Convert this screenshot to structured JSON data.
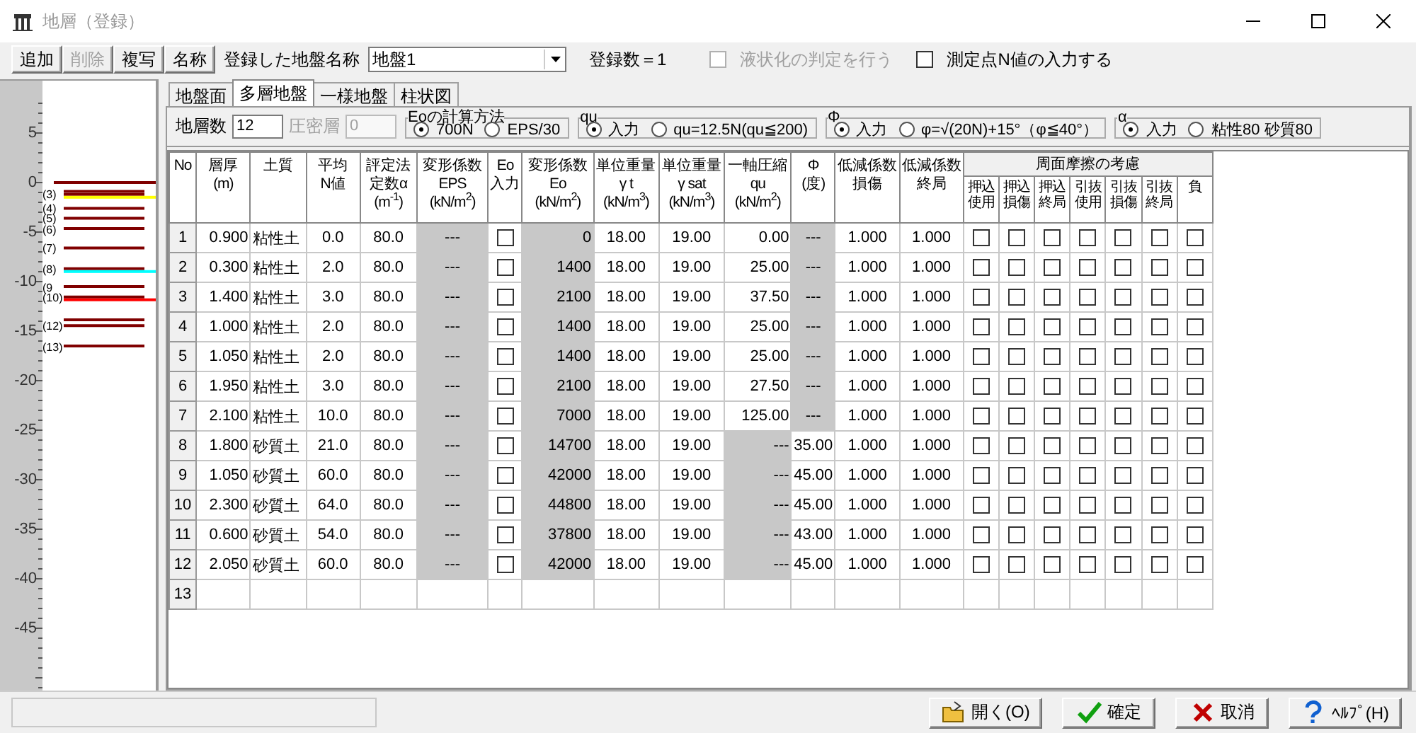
{
  "window": {
    "title": "地層（登録）",
    "active": false
  },
  "toolbar": {
    "buttons": [
      {
        "label": "追加",
        "disabled": false
      },
      {
        "label": "削除",
        "disabled": true
      },
      {
        "label": "複写",
        "disabled": false
      },
      {
        "label": "名称",
        "disabled": false
      }
    ],
    "name_label": "登録した地盤名称",
    "name_value": "地盤1",
    "count": "登録数＝1",
    "checkboxes": [
      {
        "label": "液状化の判定を行う",
        "checked": false,
        "disabled": true
      },
      {
        "label": "測定点N値の入力する",
        "checked": false,
        "disabled": false
      }
    ]
  },
  "strata_view": {
    "ruler": [
      "5",
      "0",
      "-5",
      "-10",
      "-15",
      "-20",
      "-25",
      "-30",
      "-35",
      "-40",
      "-45"
    ]
  },
  "tabs": [
    {
      "label": "地盤面",
      "selected": false
    },
    {
      "label": "多層地盤",
      "selected": true
    },
    {
      "label": "一様地盤",
      "selected": false
    },
    {
      "label": "柱状図",
      "selected": false
    }
  ],
  "settings": {
    "layer_count_label": "地層数",
    "layer_count": "12",
    "consolidation_label": "圧密層",
    "consolidation": "0",
    "consolidation_disabled": true,
    "groups": [
      {
        "title": "Eoの計算方法",
        "options": [
          {
            "label": "700N",
            "selected": true
          },
          {
            "label": "EPS/30",
            "selected": false
          }
        ]
      },
      {
        "title": "qu",
        "options": [
          {
            "label": "入力",
            "selected": true
          },
          {
            "label": "qu=12.5N(qu≦200)",
            "selected": false
          }
        ]
      },
      {
        "title": "Φ",
        "options": [
          {
            "label": "入力",
            "selected": true
          },
          {
            "label": "φ=√(20N)+15°（φ≦40°）",
            "selected": false
          }
        ]
      },
      {
        "title": "α",
        "options": [
          {
            "label": "入力",
            "selected": true
          },
          {
            "label": "粘性80  砂質80",
            "selected": false
          }
        ]
      }
    ]
  },
  "table": {
    "columns": [
      {
        "header": [
          "No"
        ],
        "kind": "no"
      },
      {
        "header": [
          "層厚",
          "(m)"
        ],
        "kind": "value"
      },
      {
        "header": [
          "土質"
        ],
        "kind": "value"
      },
      {
        "header": [
          "平均",
          "N値"
        ],
        "kind": "value"
      },
      {
        "header": [
          "評定法",
          "定数α",
          "(m$^{-1}$)"
        ],
        "kind": "value"
      },
      {
        "header": [
          "変形係数",
          "EPS",
          "(kN/m$^{2}$)"
        ],
        "kind": "value"
      },
      {
        "header": [
          "Eo",
          "入力"
        ],
        "kind": "check"
      },
      {
        "header": [
          "変形係数",
          "Eo",
          "(kN/m$^{2}$)"
        ],
        "kind": "value"
      },
      {
        "header": [
          "単位重量",
          "γ t",
          "(kN/m$^{3}$)"
        ],
        "kind": "value"
      },
      {
        "header": [
          "単位重量",
          "γ sat",
          "(kN/m$^{3}$)"
        ],
        "kind": "value"
      },
      {
        "header": [
          "一軸圧縮",
          "qu",
          "(kN/m$^{2}$)"
        ],
        "kind": "value"
      },
      {
        "header": [
          "Φ",
          "(度)"
        ],
        "kind": "value"
      },
      {
        "header": [
          "低減係数",
          "損傷"
        ],
        "kind": "value"
      },
      {
        "header": [
          "低減係数",
          "終局"
        ],
        "kind": "value"
      }
    ],
    "friction_header": "周面摩擦の考慮",
    "friction_columns": [
      [
        "押込",
        "使用"
      ],
      [
        "押込",
        "損傷"
      ],
      [
        "押込",
        "終局"
      ],
      [
        "引抜",
        "使用"
      ],
      [
        "引抜",
        "損傷"
      ],
      [
        "引抜",
        "終局"
      ],
      [
        "負"
      ]
    ],
    "rows": [
      {
        "no": "1",
        "values": [
          "0.900",
          "粘性土",
          "0.0",
          "80.0",
          "---",
          "0",
          "18.00",
          "19.00",
          "0.00",
          "---",
          "1.000",
          "1.000"
        ],
        "shaded": [
          false,
          false,
          false,
          false,
          true,
          true,
          false,
          false,
          false,
          true,
          false,
          false
        ],
        "eo_input": false,
        "friction": [
          false,
          false,
          false,
          false,
          false,
          false,
          false
        ]
      },
      {
        "no": "2",
        "values": [
          "0.300",
          "粘性土",
          "2.0",
          "80.0",
          "---",
          "1400",
          "18.00",
          "19.00",
          "25.00",
          "---",
          "1.000",
          "1.000"
        ],
        "shaded": [
          false,
          false,
          false,
          false,
          true,
          true,
          false,
          false,
          false,
          true,
          false,
          false
        ],
        "eo_input": false,
        "friction": [
          false,
          false,
          false,
          false,
          false,
          false,
          false
        ],
        "color": "#ffff00"
      },
      {
        "no": "3",
        "values": [
          "1.400",
          "粘性土",
          "3.0",
          "80.0",
          "---",
          "2100",
          "18.00",
          "19.00",
          "37.50",
          "---",
          "1.000",
          "1.000"
        ],
        "shaded": [
          false,
          false,
          false,
          false,
          true,
          true,
          false,
          false,
          false,
          true,
          false,
          false
        ],
        "eo_input": false,
        "friction": [
          false,
          false,
          false,
          false,
          false,
          false,
          false
        ],
        "label": "(3)"
      },
      {
        "no": "4",
        "values": [
          "1.000",
          "粘性土",
          "2.0",
          "80.0",
          "---",
          "1400",
          "18.00",
          "19.00",
          "25.00",
          "---",
          "1.000",
          "1.000"
        ],
        "shaded": [
          false,
          false,
          false,
          false,
          true,
          true,
          false,
          false,
          false,
          true,
          false,
          false
        ],
        "eo_input": false,
        "friction": [
          false,
          false,
          false,
          false,
          false,
          false,
          false
        ],
        "label": "(4)"
      },
      {
        "no": "5",
        "values": [
          "1.050",
          "粘性土",
          "2.0",
          "80.0",
          "---",
          "1400",
          "18.00",
          "19.00",
          "25.00",
          "---",
          "1.000",
          "1.000"
        ],
        "shaded": [
          false,
          false,
          false,
          false,
          true,
          true,
          false,
          false,
          false,
          true,
          false,
          false
        ],
        "eo_input": false,
        "friction": [
          false,
          false,
          false,
          false,
          false,
          false,
          false
        ],
        "label": "(5)"
      },
      {
        "no": "6",
        "values": [
          "1.950",
          "粘性土",
          "3.0",
          "80.0",
          "---",
          "2100",
          "18.00",
          "19.00",
          "27.50",
          "---",
          "1.000",
          "1.000"
        ],
        "shaded": [
          false,
          false,
          false,
          false,
          true,
          true,
          false,
          false,
          false,
          true,
          false,
          false
        ],
        "eo_input": false,
        "friction": [
          false,
          false,
          false,
          false,
          false,
          false,
          false
        ],
        "label": "(6)"
      },
      {
        "no": "7",
        "values": [
          "2.100",
          "粘性土",
          "10.0",
          "80.0",
          "---",
          "7000",
          "18.00",
          "19.00",
          "125.00",
          "---",
          "1.000",
          "1.000"
        ],
        "shaded": [
          false,
          false,
          false,
          false,
          true,
          true,
          false,
          false,
          false,
          true,
          false,
          false
        ],
        "eo_input": false,
        "friction": [
          false,
          false,
          false,
          false,
          false,
          false,
          false
        ],
        "label": "(7)",
        "color": "#00ffff"
      },
      {
        "no": "8",
        "values": [
          "1.800",
          "砂質土",
          "21.0",
          "80.0",
          "---",
          "14700",
          "18.00",
          "19.00",
          "---",
          "35.00",
          "1.000",
          "1.000"
        ],
        "shaded": [
          false,
          false,
          false,
          false,
          true,
          true,
          false,
          false,
          true,
          false,
          false,
          false
        ],
        "eo_input": false,
        "friction": [
          false,
          false,
          false,
          false,
          false,
          false,
          false
        ],
        "label": "(8)"
      },
      {
        "no": "9",
        "values": [
          "1.050",
          "砂質土",
          "60.0",
          "80.0",
          "---",
          "42000",
          "18.00",
          "19.00",
          "---",
          "45.00",
          "1.000",
          "1.000"
        ],
        "shaded": [
          false,
          false,
          false,
          false,
          true,
          true,
          false,
          false,
          true,
          false,
          false,
          false
        ],
        "eo_input": false,
        "friction": [
          false,
          false,
          false,
          false,
          false,
          false,
          false
        ],
        "label": "(9",
        "color": "#ff0000"
      },
      {
        "no": "10",
        "values": [
          "2.300",
          "砂質土",
          "64.0",
          "80.0",
          "---",
          "44800",
          "18.00",
          "19.00",
          "---",
          "45.00",
          "1.000",
          "1.000"
        ],
        "shaded": [
          false,
          false,
          false,
          false,
          true,
          true,
          false,
          false,
          true,
          false,
          false,
          false
        ],
        "eo_input": false,
        "friction": [
          false,
          false,
          false,
          false,
          false,
          false,
          false
        ],
        "label": "(10)"
      },
      {
        "no": "11",
        "values": [
          "0.600",
          "砂質土",
          "54.0",
          "80.0",
          "---",
          "37800",
          "18.00",
          "19.00",
          "---",
          "43.00",
          "1.000",
          "1.000"
        ],
        "shaded": [
          false,
          false,
          false,
          false,
          true,
          true,
          false,
          false,
          true,
          false,
          false,
          false
        ],
        "eo_input": false,
        "friction": [
          false,
          false,
          false,
          false,
          false,
          false,
          false
        ]
      },
      {
        "no": "12",
        "values": [
          "2.050",
          "砂質土",
          "60.0",
          "80.0",
          "---",
          "42000",
          "18.00",
          "19.00",
          "---",
          "45.00",
          "1.000",
          "1.000"
        ],
        "shaded": [
          false,
          false,
          false,
          false,
          true,
          true,
          false,
          false,
          true,
          false,
          false,
          false
        ],
        "eo_input": false,
        "friction": [
          false,
          false,
          false,
          false,
          false,
          false,
          false
        ],
        "label": "(12)"
      },
      {
        "no": "13",
        "label": "(13)"
      }
    ]
  },
  "status_bar": {
    "buttons": [
      {
        "label": "開く(O)",
        "kind": "open"
      },
      {
        "label": "確定",
        "kind": "ok"
      },
      {
        "label": "取消",
        "kind": "cancel"
      },
      {
        "label": "ﾍﾙﾌﾟ(H)",
        "kind": "help"
      }
    ]
  }
}
